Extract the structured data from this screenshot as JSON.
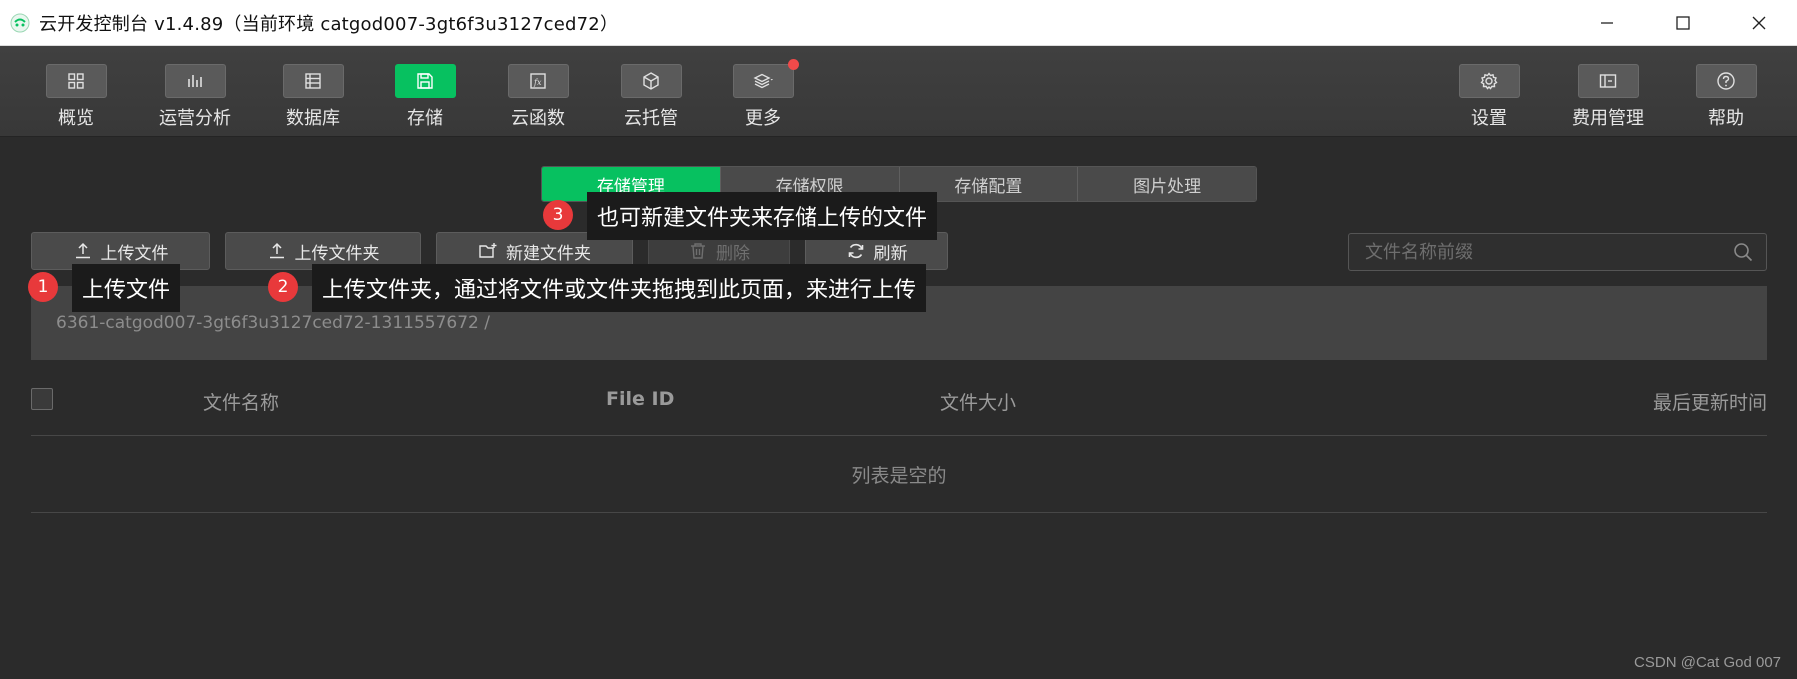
{
  "window": {
    "title": "云开发控制台 v1.4.89（当前环境 catgod007-3gt6f3u3127ced72）"
  },
  "toolbar": {
    "items": [
      {
        "label": "概览",
        "icon": "grid-icon"
      },
      {
        "label": "运营分析",
        "icon": "bar-chart-icon"
      },
      {
        "label": "数据库",
        "icon": "database-icon"
      },
      {
        "label": "存储",
        "icon": "floppy-disk-icon",
        "active": true
      },
      {
        "label": "云函数",
        "icon": "function-icon"
      },
      {
        "label": "云托管",
        "icon": "cube-icon"
      },
      {
        "label": "更多",
        "icon": "layers-icon"
      }
    ],
    "right_items": [
      {
        "label": "设置",
        "icon": "gear-icon"
      },
      {
        "label": "费用管理",
        "icon": "wallet-icon"
      },
      {
        "label": "帮助",
        "icon": "help-icon"
      }
    ]
  },
  "tabs": [
    {
      "label": "存储管理",
      "active": true
    },
    {
      "label": "存储权限"
    },
    {
      "label": "存储配置"
    },
    {
      "label": "图片处理"
    }
  ],
  "actions": {
    "upload_file": "上传文件",
    "upload_folder": "上传文件夹",
    "new_folder": "新建文件夹",
    "delete": "删除",
    "refresh": "刷新"
  },
  "search": {
    "placeholder": "文件名称前缀"
  },
  "path": "6361-catgod007-3gt6f3u3127ced72-1311557672 /",
  "table": {
    "columns": [
      "文件名称",
      "File ID",
      "文件大小",
      "最后更新时间"
    ],
    "empty_text": "列表是空的"
  },
  "annotations": [
    {
      "number": "1",
      "text": "上传文件"
    },
    {
      "number": "2",
      "text": "上传文件夹，通过将文件或文件夹拖拽到此页面，来进行上传"
    },
    {
      "number": "3",
      "text": "也可新建文件夹来存储上传的文件"
    }
  ],
  "watermark": "CSDN @Cat God 007",
  "colors": {
    "accent": "#07c160",
    "badge": "#e8393b",
    "background": "#2b2b2b"
  }
}
